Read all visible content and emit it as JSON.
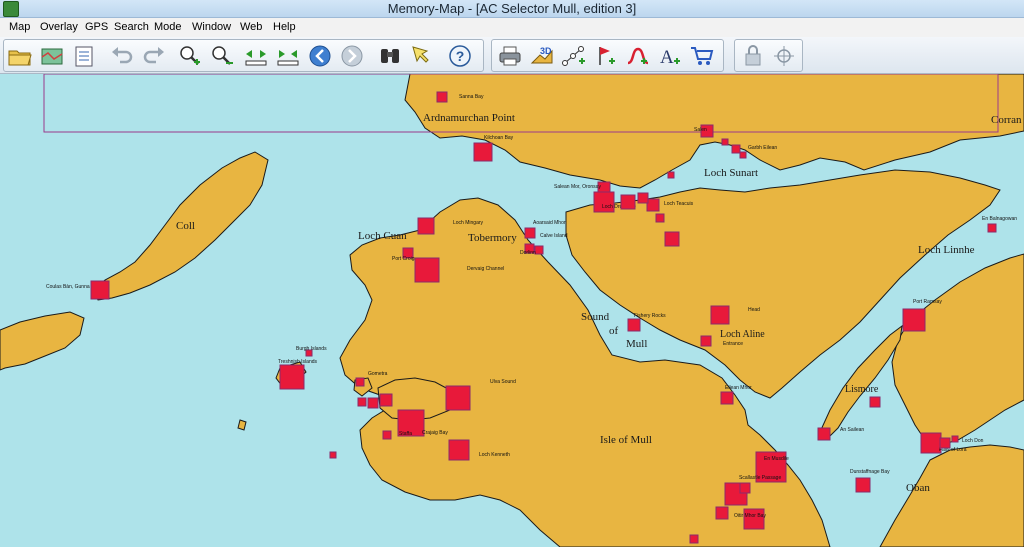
{
  "window": {
    "title": "Memory-Map - [AC Selector Mull, edition 3]"
  },
  "menu": [
    "Map",
    "Overlay",
    "GPS",
    "Search",
    "Mode",
    "Window",
    "Web",
    "Help"
  ],
  "toolbar": {
    "groups": [
      [
        "open-folder-icon",
        "overlay-map-icon",
        "checklist-icon",
        "undo-icon",
        "redo-icon",
        "zoom-in-icon",
        "zoom-out-icon",
        "scale-in-icon",
        "scale-out-icon",
        "back-icon",
        "forward-icon",
        "binoculars-icon",
        "select-pointer-icon",
        "help-icon"
      ],
      [
        "print-icon",
        "3d-view-icon",
        "route-icon",
        "mark-icon",
        "track-icon",
        "text-icon",
        "shop-icon"
      ],
      [
        "lock-icon",
        "position-icon"
      ]
    ]
  },
  "map": {
    "colors": {
      "sea": "#aee3ea",
      "land": "#e8b541",
      "marker": "#e8193a",
      "marker_border": "#8a2a6a",
      "chart_border": "#9b3a8a"
    },
    "place_labels": [
      {
        "text": "Ardnamurchan Point",
        "size": "large"
      },
      {
        "text": "Corran",
        "size": "large"
      },
      {
        "text": "Coll",
        "size": "large"
      },
      {
        "text": "Loch Cuan",
        "size": "large"
      },
      {
        "text": "Tobermory",
        "size": "large"
      },
      {
        "text": "Loch Sunart",
        "size": "large"
      },
      {
        "text": "Loch Linnhe",
        "size": "large"
      },
      {
        "text": "Sound",
        "size": "large"
      },
      {
        "text": "of",
        "size": "large"
      },
      {
        "text": "Mull",
        "size": "large"
      },
      {
        "text": "Loch Aline",
        "size": "large"
      },
      {
        "text": "Isle of Mull",
        "size": "large"
      },
      {
        "text": "Lismore",
        "size": "large"
      },
      {
        "text": "Oban",
        "size": "large"
      }
    ],
    "anchorage_labels": [
      "Sanna Bay",
      "Kilchoan Bay",
      "Salen",
      "Garbh Eilean",
      "Salean Mor, Oronsay",
      "Loch Drumbuie",
      "Loch Teacuis",
      "Loch Mingary",
      "Aoarsaid Mhor",
      "Calve Island",
      "Dorlinn",
      "Port Croig",
      "Dervaig Channel",
      "Coulas Bàn, Gunna",
      "En Balnagowan",
      "Port Ramsay",
      "Fishery Rocks",
      "Head",
      "Entrance",
      "Burgh Islands",
      "Treshnish Islands",
      "Gometra",
      "Ulva Sound",
      "Crajaig Bay",
      "Staffa",
      "Loch Kenneth",
      "An Sailean",
      "Eilean Mhor",
      "En Musdile",
      "Scallastle Passage",
      "Dunstaffnage Bay",
      "Falls of Lora",
      "Loch Don",
      "Oitir Mhor Bay",
      "Loch Spelve"
    ]
  }
}
